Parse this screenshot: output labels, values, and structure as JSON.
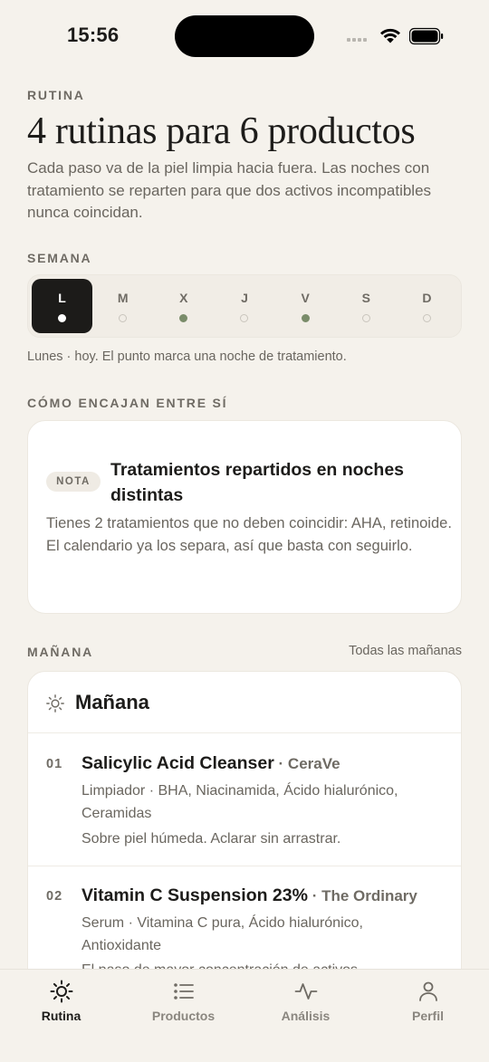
{
  "status_bar": {
    "time": "15:56"
  },
  "header": {
    "eyebrow": "RUTINA",
    "title": "4 rutinas para 6 productos",
    "description": "Cada paso va de la piel limpia hacia fuera. Las noches con tratamiento se reparten para que dos activos incompatibles nunca coincidan."
  },
  "week": {
    "eyebrow": "SEMANA",
    "days": [
      {
        "letter": "L",
        "treatment": false,
        "selected": true
      },
      {
        "letter": "M",
        "treatment": false,
        "selected": false
      },
      {
        "letter": "X",
        "treatment": true,
        "selected": false
      },
      {
        "letter": "J",
        "treatment": false,
        "selected": false
      },
      {
        "letter": "V",
        "treatment": true,
        "selected": false
      },
      {
        "letter": "S",
        "treatment": false,
        "selected": false
      },
      {
        "letter": "D",
        "treatment": false,
        "selected": false
      }
    ],
    "caption": "Lunes · hoy. El punto marca una noche de tratamiento."
  },
  "compat": {
    "eyebrow": "CÓMO ENCAJAN ENTRE SÍ",
    "pill": "NOTA",
    "title": "Tratamientos repartidos en noches distintas",
    "body": "Tienes 2 tratamientos que no deben coincidir: AHA, retinoide. El calendario ya los separa, así que basta con seguirlo."
  },
  "morning": {
    "eyebrow": "MAÑANA",
    "see_all": "Todas las mañanas",
    "title": "Mañana",
    "steps": [
      {
        "num": "01",
        "name": "Salicylic Acid Cleanser",
        "brand": " · CeraVe",
        "ingredients": "Limpiador · BHA, Niacinamida, Ácido hialurónico, Ceramidas",
        "note": "Sobre piel húmeda. Aclarar sin arrastrar."
      },
      {
        "num": "02",
        "name": "Vitamin C Suspension 23%",
        "brand": " · The Ordinary",
        "ingredients": "Serum · Vitamina C pura, Ácido hialurónico, Antioxidante",
        "note": "El paso de mayor concentración de activos."
      }
    ]
  },
  "tabs": [
    {
      "label": "Rutina",
      "icon": "sun-icon",
      "active": true
    },
    {
      "label": "Productos",
      "icon": "list-icon",
      "active": false
    },
    {
      "label": "Análisis",
      "icon": "activity-icon",
      "active": false
    },
    {
      "label": "Perfil",
      "icon": "person-icon",
      "active": false
    }
  ],
  "colors": {
    "background": "#f5f2ec",
    "text": "#1d1c1a",
    "muted": "#6a665f",
    "treatment_dot": "#7a8c6a",
    "selected_day": "#1c1b19"
  }
}
